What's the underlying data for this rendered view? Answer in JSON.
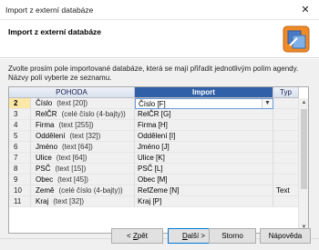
{
  "window": {
    "title": "Import z externí databáze"
  },
  "header": {
    "heading": "Import z externí databáze"
  },
  "instructions": "Zvolte prosím pole importované databáze, která se mají přiřadit jednotlivým polím agendy. Názvy polí vyberte ze seznamu.",
  "grid": {
    "columns": {
      "pohoda": "POHODA",
      "import": "Import",
      "typ": "Typ"
    },
    "rows": [
      {
        "num": "2",
        "field": "Číslo",
        "type": "(text [20])",
        "import": "Číslo [F]",
        "typ": ""
      },
      {
        "num": "3",
        "field": "RelČR",
        "type": "(celé číslo (4-bajty))",
        "import": "RelČR [G]",
        "typ": ""
      },
      {
        "num": "4",
        "field": "Firma",
        "type": "(text [255])",
        "import": "Firma [H]",
        "typ": ""
      },
      {
        "num": "5",
        "field": "Oddělení",
        "type": "(text [32])",
        "import": "Oddělení [I]",
        "typ": ""
      },
      {
        "num": "6",
        "field": "Jméno",
        "type": "(text [64])",
        "import": "Jméno [J]",
        "typ": ""
      },
      {
        "num": "7",
        "field": "Ulice",
        "type": "(text [64])",
        "import": "Ulice [K]",
        "typ": ""
      },
      {
        "num": "8",
        "field": "PSČ",
        "type": "(text [15])",
        "import": "PSČ [L]",
        "typ": ""
      },
      {
        "num": "9",
        "field": "Obec",
        "type": "(text [45])",
        "import": "Obec [M]",
        "typ": ""
      },
      {
        "num": "10",
        "field": "Země",
        "type": "(celé číslo (4-bajty))",
        "import": "RefZeme [N]",
        "typ": "Text"
      },
      {
        "num": "11",
        "field": "Kraj",
        "type": "(text [32])",
        "import": "Kraj [P]",
        "typ": ""
      }
    ]
  },
  "buttons": {
    "back": {
      "prefix": "< ",
      "key": "Z",
      "rest": "pět"
    },
    "next": {
      "prefix": "",
      "key": "D",
      "rest": "alší >"
    },
    "cancel": "Storno",
    "help": "Nápověda"
  }
}
